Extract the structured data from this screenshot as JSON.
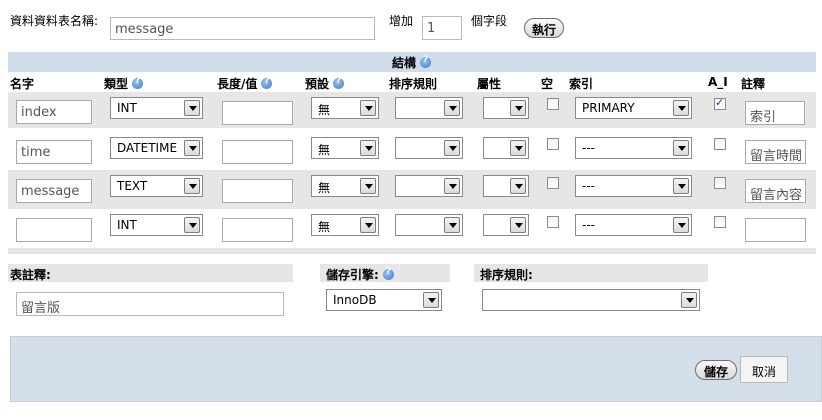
{
  "table_name": {
    "label": "資料資料表名稱:",
    "value": "message"
  },
  "add_fields": {
    "label": "增加",
    "value": "1",
    "suffix": "個字段",
    "go_label": "執行"
  },
  "structure": {
    "title": "結構"
  },
  "columns": {
    "name": "名字",
    "type": "類型",
    "length": "長度/值",
    "default": "預設",
    "collation": "排序規則",
    "attributes": "屬性",
    "null": "空",
    "index": "索引",
    "ai": "A_I",
    "comment": "註釋"
  },
  "rows": [
    {
      "name": "index",
      "type": "INT",
      "default": "無",
      "index": "PRIMARY",
      "ai": true,
      "comment": "索引"
    },
    {
      "name": "time",
      "type": "DATETIME",
      "default": "無",
      "index": "---",
      "ai": false,
      "comment": "留言時間"
    },
    {
      "name": "message",
      "type": "TEXT",
      "default": "無",
      "index": "---",
      "ai": false,
      "comment": "留言內容"
    },
    {
      "name": "",
      "type": "INT",
      "default": "無",
      "index": "---",
      "ai": false,
      "comment": ""
    }
  ],
  "table_comment": {
    "label": "表註釋:",
    "value": "留言版"
  },
  "engine": {
    "label": "儲存引擎:",
    "value": "InnoDB"
  },
  "table_collation": {
    "label": "排序規則:",
    "value": ""
  },
  "footer": {
    "save_label": "儲存",
    "cancel_label": "取消"
  }
}
